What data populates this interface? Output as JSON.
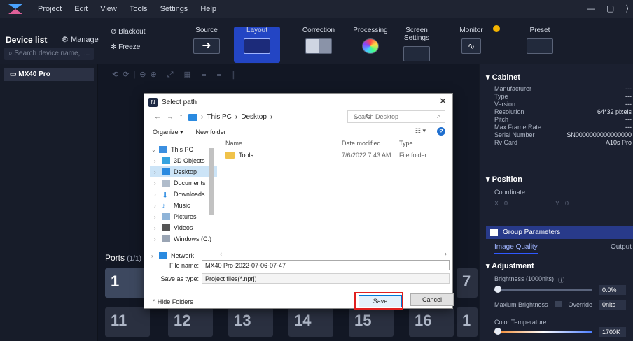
{
  "menu": {
    "items": [
      "Project",
      "Edit",
      "View",
      "Tools",
      "Settings",
      "Help"
    ],
    "win": [
      "—",
      "▢",
      "⟩"
    ]
  },
  "sidebar": {
    "title": "Device list",
    "manage": "Manage",
    "search_placeholder": "Search device name, I...",
    "device": "MX40 Pro"
  },
  "toolbar": {
    "blackout": "Blackout",
    "freeze": "Freeze",
    "buttons": [
      "Source",
      "Layout",
      "Correction",
      "Processing",
      "Screen Settings",
      "Monitor",
      "Preset"
    ]
  },
  "cabinet": {
    "title": "Cabinet",
    "rows": [
      {
        "k": "Manufacturer",
        "v": "---"
      },
      {
        "k": "Type",
        "v": "---"
      },
      {
        "k": "Version",
        "v": "---"
      },
      {
        "k": "Resolution",
        "v": "64*32 pixels"
      },
      {
        "k": "Pitch",
        "v": "---"
      },
      {
        "k": "Max Frame Rate",
        "v": "---"
      },
      {
        "k": "Serial Number",
        "v": "SN0000000000000000"
      },
      {
        "k": "Rv Card",
        "v": "A10s Pro"
      }
    ]
  },
  "position": {
    "title": "Position",
    "coord_label": "Coordinate",
    "x": "X",
    "x_val": "0",
    "y": "Y",
    "y_val": "0"
  },
  "group": {
    "title": "Group Parameters",
    "tab1": "Image Quality",
    "tab2": "Output"
  },
  "adjustment": {
    "title": "Adjustment",
    "brightness_label": "Brightness (1000nits)",
    "brightness_val": "0.0%",
    "max_label": "Maxium Brightness",
    "override": "Override",
    "max_val": "0nits",
    "color_temp": "Color Temperature",
    "color_val": "1700K"
  },
  "ports": {
    "label": "Ports",
    "count": "(1/1)",
    "cells": [
      "1",
      "11",
      "12",
      "13",
      "14",
      "15",
      "16",
      "1",
      "7"
    ]
  },
  "dialog": {
    "title": "Select path",
    "path": [
      "This PC",
      "Desktop"
    ],
    "search_placeholder": "Search Desktop",
    "organize": "Organize ▾",
    "new_folder": "New folder",
    "nav": [
      "This PC",
      "3D Objects",
      "Desktop",
      "Documents",
      "Downloads",
      "Music",
      "Pictures",
      "Videos",
      "Windows (C:)",
      "Network"
    ],
    "columns": [
      "Name",
      "Date modified",
      "Type"
    ],
    "rows": [
      {
        "name": "Tools",
        "date": "7/6/2022 7:43 AM",
        "type": "File folder"
      }
    ],
    "file_name_label": "File name:",
    "file_name": "MX40 Pro-2022-07-06-07-47",
    "save_type_label": "Save as type:",
    "save_type": "Project files(*.nprj)",
    "hide": "Hide Folders",
    "save": "Save",
    "cancel": "Cancel"
  },
  "colors": {
    "accent": "#2345c4",
    "highlight": "#e02020"
  }
}
